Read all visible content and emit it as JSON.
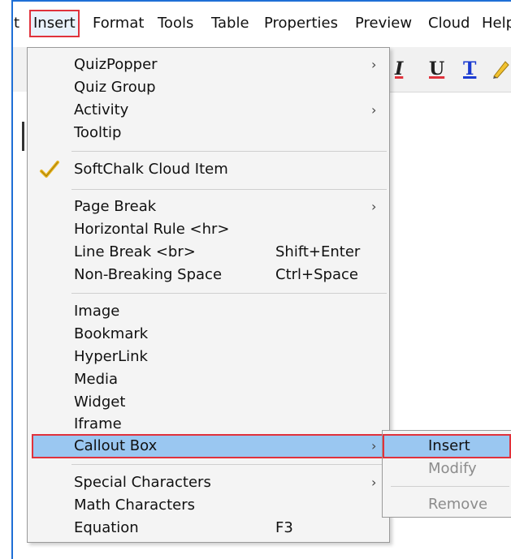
{
  "menubar": {
    "items": [
      "t",
      "Insert",
      "Format",
      "Tools",
      "Table",
      "Properties",
      "Preview",
      "Cloud",
      "Help"
    ]
  },
  "toolbar": {
    "italic": "I",
    "underline": "U",
    "text_color": "T"
  },
  "insert_menu": {
    "quizpopper": "QuizPopper",
    "quiz_group": "Quiz Group",
    "activity": "Activity",
    "tooltip": "Tooltip",
    "softchalk_cloud_item": "SoftChalk Cloud Item",
    "page_break": "Page Break",
    "horizontal_rule": "Horizontal Rule <hr>",
    "line_break": "Line Break <br>",
    "line_break_shortcut": "Shift+Enter",
    "non_breaking_space": "Non-Breaking Space",
    "non_breaking_space_shortcut": "Ctrl+Space",
    "image": "Image",
    "bookmark": "Bookmark",
    "hyperlink": "HyperLink",
    "media": "Media",
    "widget": "Widget",
    "iframe": "Iframe",
    "callout_box": "Callout Box",
    "special_characters": "Special Characters",
    "math_characters": "Math Characters",
    "equation": "Equation",
    "equation_shortcut": "F3",
    "submenu_arrow": "›"
  },
  "callout_submenu": {
    "insert": "Insert",
    "modify": "Modify",
    "remove": "Remove"
  },
  "colors": {
    "highlight": "#9ac7f1",
    "annotation_red": "#e0323c",
    "menu_bg": "#f4f4f4"
  },
  "icons": {
    "softchalk_cloud_item": "check-icon"
  }
}
